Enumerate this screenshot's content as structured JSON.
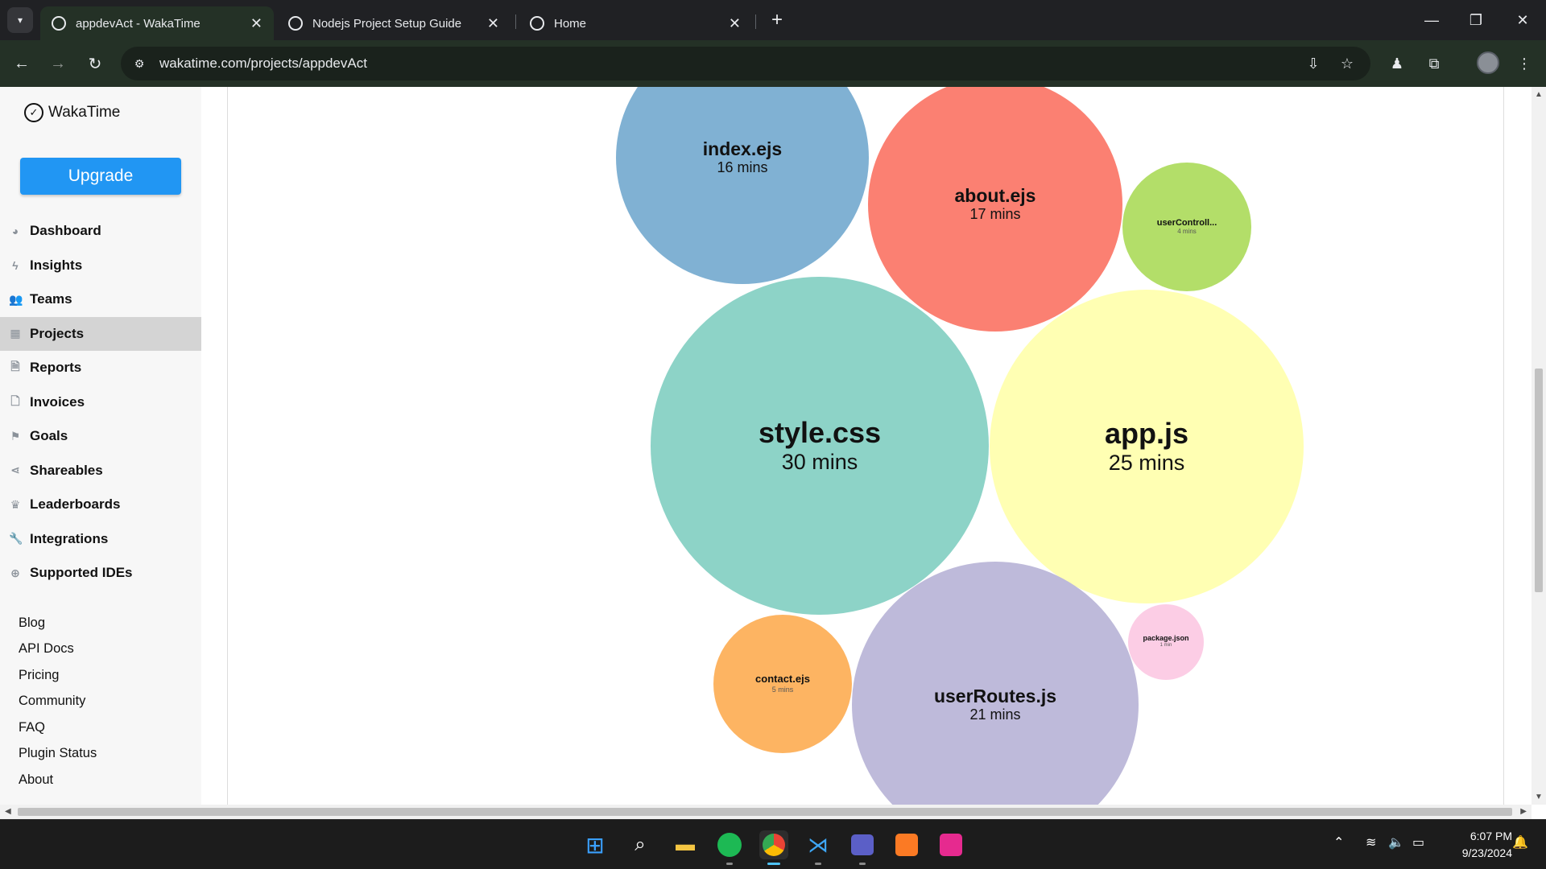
{
  "browser": {
    "tabs": [
      {
        "title": "appdevAct - WakaTime",
        "active": true
      },
      {
        "title": "Nodejs Project Setup Guide",
        "active": false
      },
      {
        "title": "Home",
        "active": false
      }
    ],
    "url": "wakatime.com/projects/appdevAct"
  },
  "sidebar": {
    "brand": "WakaTime",
    "upgrade_label": "Upgrade",
    "nav": [
      {
        "label": "Dashboard",
        "icon": "palette-icon"
      },
      {
        "label": "Insights",
        "icon": "bolt-icon"
      },
      {
        "label": "Teams",
        "icon": "users-icon"
      },
      {
        "label": "Projects",
        "icon": "grid-icon",
        "active": true
      },
      {
        "label": "Reports",
        "icon": "file-pdf-icon"
      },
      {
        "label": "Invoices",
        "icon": "file-icon"
      },
      {
        "label": "Goals",
        "icon": "flag-icon"
      },
      {
        "label": "Shareables",
        "icon": "share-icon"
      },
      {
        "label": "Leaderboards",
        "icon": "trophy-icon"
      },
      {
        "label": "Integrations",
        "icon": "wrench-icon"
      },
      {
        "label": "Supported IDEs",
        "icon": "plus-circle-icon"
      }
    ],
    "links": [
      "Blog",
      "API Docs",
      "Pricing",
      "Community",
      "FAQ",
      "Plugin Status",
      "About"
    ]
  },
  "chart_data": {
    "type": "bubble",
    "items": [
      {
        "name": "index.ejs",
        "duration": "16 mins",
        "minutes": 16,
        "color": "#80b1d3"
      },
      {
        "name": "about.ejs",
        "duration": "17 mins",
        "minutes": 17,
        "color": "#fb8072"
      },
      {
        "name": "userControll...",
        "duration": "4 mins",
        "minutes": 4,
        "color": "#b3de69"
      },
      {
        "name": "style.css",
        "duration": "30 mins",
        "minutes": 30,
        "color": "#8dd3c7"
      },
      {
        "name": "app.js",
        "duration": "25 mins",
        "minutes": 25,
        "color": "#ffffb3"
      },
      {
        "name": "contact.ejs",
        "duration": "5 mins",
        "minutes": 5,
        "color": "#fdb462"
      },
      {
        "name": "userRoutes.js",
        "duration": "21 mins",
        "minutes": 21,
        "color": "#bebada"
      },
      {
        "name": "package.json",
        "duration": "1 min",
        "minutes": 1,
        "color": "#fccde5"
      }
    ]
  },
  "taskbar": {
    "time": "6:07 PM",
    "date": "9/23/2024"
  }
}
